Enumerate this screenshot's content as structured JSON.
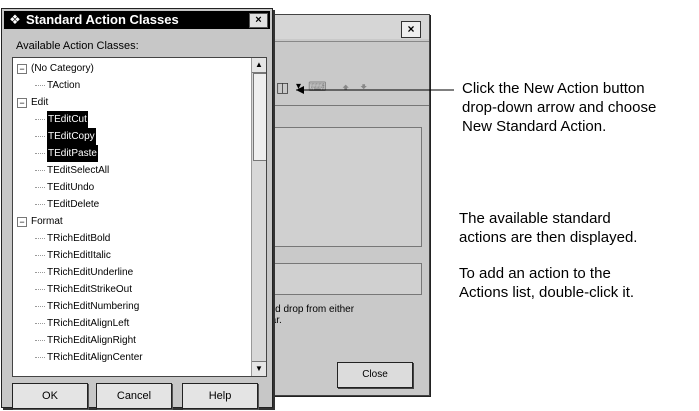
{
  "background_window": {
    "close_glyph": "×",
    "hint_text": "and drop from either\nBar.",
    "close_button_label": "Close"
  },
  "dialog": {
    "title": "Standard Action Classes",
    "close_glyph": "×",
    "list_label": "Available Action Classes:",
    "items": [
      {
        "label": "(No Category)",
        "level": 0,
        "expander": "−"
      },
      {
        "label": "TAction",
        "level": 1
      },
      {
        "label": "Edit",
        "level": 0,
        "expander": "−"
      },
      {
        "label": "TEditCut",
        "level": 1,
        "selected": true
      },
      {
        "label": "TEditCopy",
        "level": 1,
        "selected": true
      },
      {
        "label": "TEditPaste",
        "level": 1,
        "selected": true
      },
      {
        "label": "TEditSelectAll",
        "level": 1
      },
      {
        "label": "TEditUndo",
        "level": 1
      },
      {
        "label": "TEditDelete",
        "level": 1
      },
      {
        "label": "Format",
        "level": 0,
        "expander": "−"
      },
      {
        "label": "TRichEditBold",
        "level": 1
      },
      {
        "label": "TRichEditItalic",
        "level": 1
      },
      {
        "label": "TRichEditUnderline",
        "level": 1
      },
      {
        "label": "TRichEditStrikeOut",
        "level": 1
      },
      {
        "label": "TRichEditNumbering",
        "level": 1
      },
      {
        "label": "TRichEditAlignLeft",
        "level": 1
      },
      {
        "label": "TRichEditAlignRight",
        "level": 1
      },
      {
        "label": "TRichEditAlignCenter",
        "level": 1
      }
    ],
    "buttons": {
      "ok": "OK",
      "cancel": "Cancel",
      "help": "Help"
    }
  },
  "callouts": {
    "new_action": "Click the New Action button\ndrop-down arrow and choose\nNew Standard Action.",
    "available": "The available standard\nactions are then displayed.",
    "add_action": "To add an action to the\nActions list, double-click it."
  }
}
